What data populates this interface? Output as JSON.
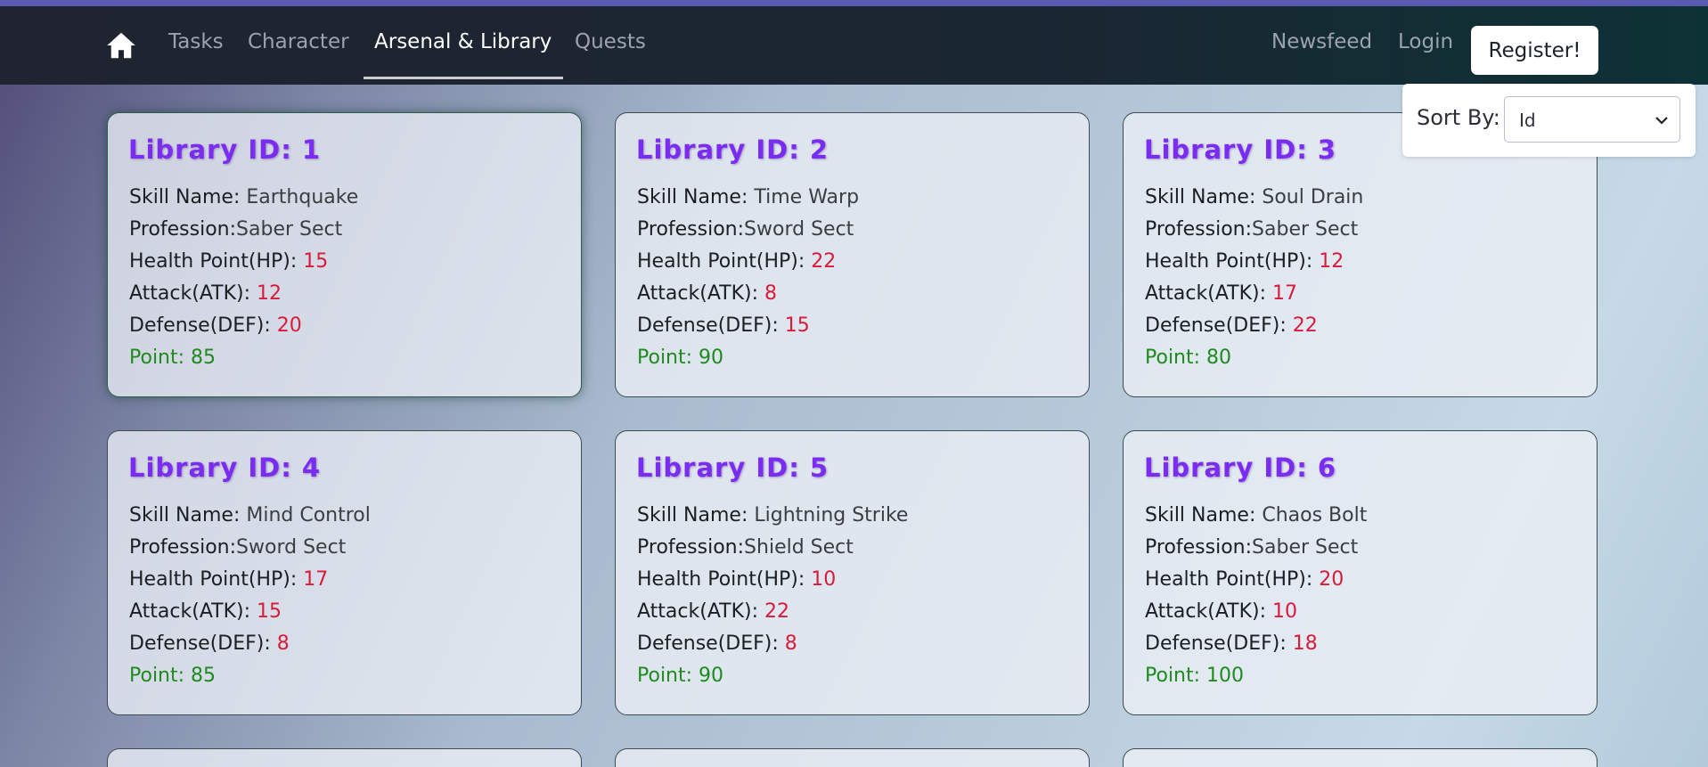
{
  "nav": {
    "links": [
      {
        "label": "Tasks"
      },
      {
        "label": "Character"
      },
      {
        "label": "Arsenal & Library"
      },
      {
        "label": "Quests"
      }
    ],
    "right": {
      "newsfeed": "Newsfeed",
      "login": "Login",
      "register": "Register!"
    }
  },
  "sort": {
    "label": "Sort By:",
    "selected": "Id"
  },
  "labels": {
    "skill": "Skill Name:",
    "profession": "Profession:",
    "hp": "Health Point(HP):",
    "atk": "Attack(ATK):",
    "def": "Defense(DEF):",
    "point": "Point:"
  },
  "cards": [
    {
      "title": "Library ID: 1",
      "skill": "Earthquake",
      "profession": "Saber Sect",
      "hp": "15",
      "atk": "12",
      "def": "20",
      "point": "85"
    },
    {
      "title": "Library ID: 2",
      "skill": "Time Warp",
      "profession": "Sword Sect",
      "hp": "22",
      "atk": "8",
      "def": "15",
      "point": "90"
    },
    {
      "title": "Library ID: 3",
      "skill": "Soul Drain",
      "profession": "Saber Sect",
      "hp": "12",
      "atk": "17",
      "def": "22",
      "point": "80"
    },
    {
      "title": "Library ID: 4",
      "skill": "Mind Control",
      "profession": "Sword Sect",
      "hp": "17",
      "atk": "15",
      "def": "8",
      "point": "85"
    },
    {
      "title": "Library ID: 5",
      "skill": "Lightning Strike",
      "profession": "Shield Sect",
      "hp": "10",
      "atk": "22",
      "def": "8",
      "point": "90"
    },
    {
      "title": "Library ID: 6",
      "skill": "Chaos Bolt",
      "profession": "Saber Sect",
      "hp": "20",
      "atk": "10",
      "def": "18",
      "point": "100"
    }
  ],
  "colors": {
    "title": "#7a2cf0",
    "stat_value": "#d81b3b",
    "point": "#1f8a1f"
  },
  "icons": {
    "home": "home-icon",
    "sort": "chevron-down-icon"
  }
}
